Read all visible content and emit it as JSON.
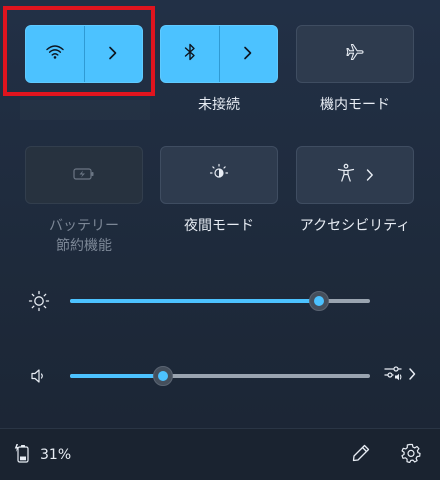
{
  "tiles": {
    "wifi": {
      "label": ""
    },
    "bluetooth": {
      "label": "未接続"
    },
    "airplane": {
      "label": "機内モード"
    },
    "battery_saver": {
      "label_line1": "バッテリー",
      "label_line2": "節約機能"
    },
    "night_light": {
      "label": "夜間モード"
    },
    "accessibility": {
      "label": "アクセシビリティ"
    }
  },
  "sliders": {
    "brightness": {
      "value_percent": 83
    },
    "volume": {
      "value_percent": 31
    }
  },
  "footer": {
    "battery_text": "31%"
  },
  "colors": {
    "accent": "#4cc2ff",
    "highlight": "#e0141e"
  },
  "icons": {
    "wifi": "wifi-icon",
    "bluetooth": "bluetooth-icon",
    "airplane": "airplane-icon",
    "battery_saver": "battery-saver-icon",
    "night_light": "night-light-icon",
    "accessibility": "accessibility-icon",
    "brightness": "brightness-icon",
    "volume": "volume-icon",
    "audio_output": "audio-output-icon",
    "battery": "battery-icon",
    "edit": "pencil-icon",
    "settings": "gear-icon",
    "chevron": "chevron-right-icon"
  }
}
